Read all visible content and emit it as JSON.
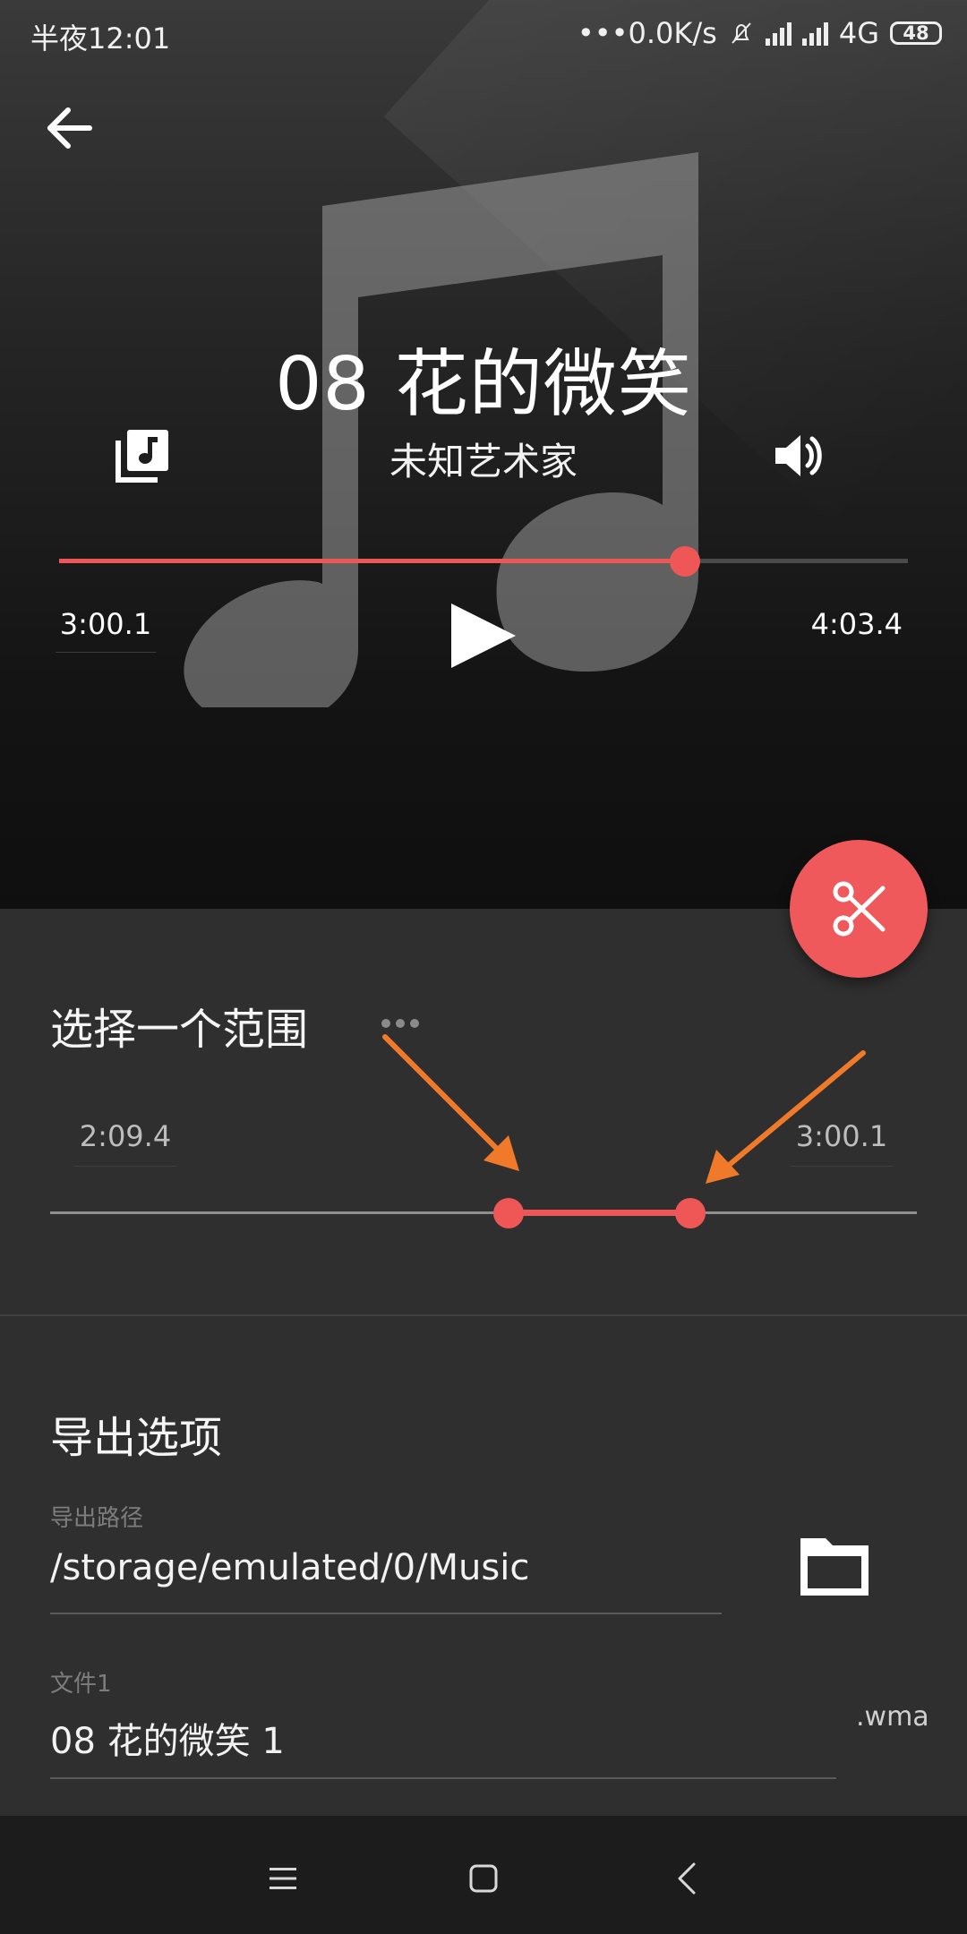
{
  "status_bar": {
    "time": "半夜12:01",
    "network_speed": "•••0.0K/s",
    "network_type": "4G",
    "battery": "48"
  },
  "player": {
    "title": "08 花的微笑",
    "artist": "未知艺术家",
    "current_time": "3:00.1",
    "total_time": "4:03.4",
    "progress_fraction": 0.737
  },
  "range": {
    "title": "选择一个范围",
    "start_time": "2:09.4",
    "end_time": "3:00.1",
    "start_fraction": 0.529,
    "end_fraction": 0.739
  },
  "export": {
    "title": "导出选项",
    "path_label": "导出路径",
    "path_value": "/storage/emulated/0/Music",
    "file_label": "文件1",
    "file_value": "08 花的微笑 1",
    "file_ext": ".wma"
  },
  "icons": {
    "back": "arrow-left-icon",
    "playlist": "playlist-icon",
    "volume": "volume-icon",
    "play": "play-icon",
    "cut": "scissors-icon",
    "folder": "folder-icon",
    "menu": "menu-icon",
    "home": "home-icon",
    "nav_back": "chevron-left-icon"
  },
  "colors": {
    "accent": "#ef5656",
    "annotation": "#f07a2a"
  }
}
